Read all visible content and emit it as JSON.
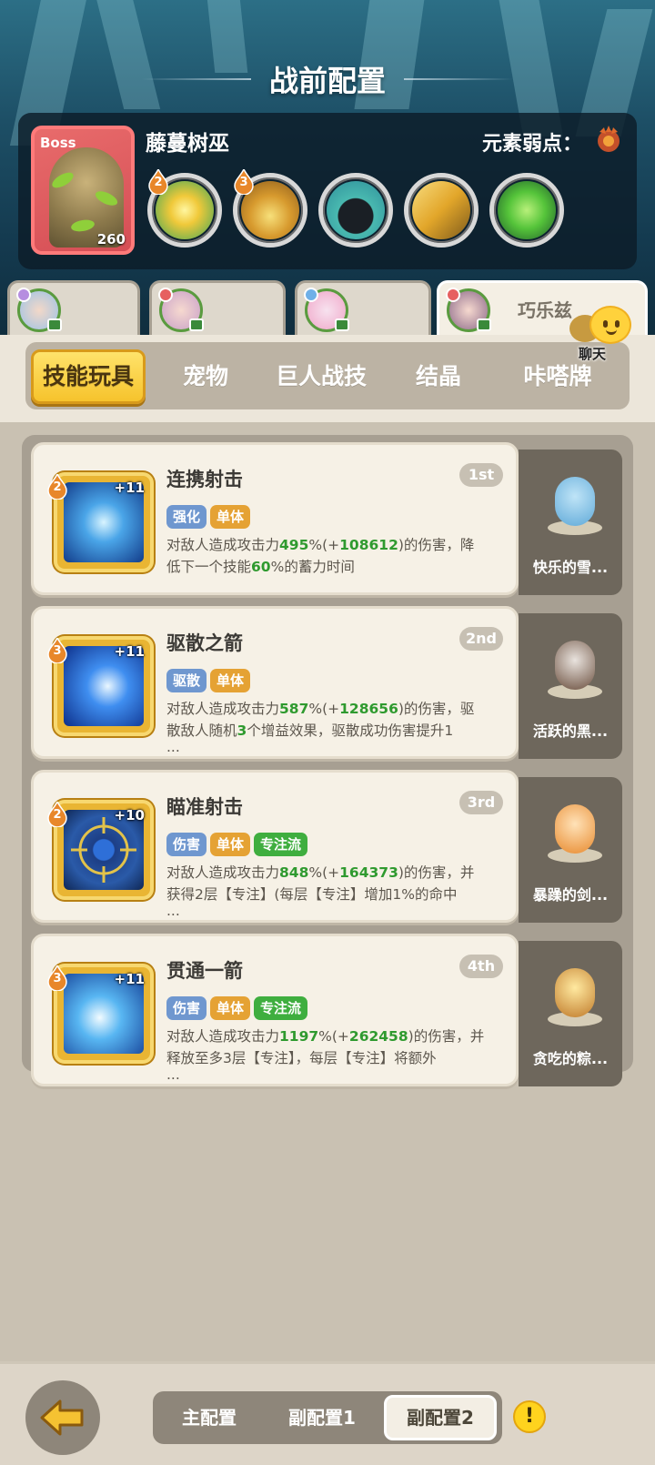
{
  "header": {
    "title": "战前配置"
  },
  "boss": {
    "tag": "Boss",
    "level": "260",
    "name": "藤蔓树巫",
    "weakness_label": "元素弱点：",
    "weakness_icon": "fire-element-icon",
    "skills": [
      {
        "icon": "explosion-skill-icon",
        "level": "2"
      },
      {
        "icon": "fire-cauldron-skill-icon",
        "level": "3"
      },
      {
        "icon": "shadow-monster-skill-icon"
      },
      {
        "icon": "golden-claw-skill-icon"
      },
      {
        "icon": "green-slime-skill-icon"
      }
    ]
  },
  "partners": [
    {
      "name": ""
    },
    {
      "name": ""
    },
    {
      "name": ""
    },
    {
      "name": "巧乐兹",
      "active": true
    }
  ],
  "chat": {
    "label": "聊天"
  },
  "categories": [
    {
      "label": "技能玩具",
      "active": true
    },
    {
      "label": "宠物"
    },
    {
      "label": "巨人战技"
    },
    {
      "label": "结晶"
    },
    {
      "label": "咔嗒牌"
    }
  ],
  "skills": [
    {
      "name": "连携射击",
      "rank": "1st",
      "level": "2",
      "plus": "+11",
      "tags": [
        {
          "text": "强化",
          "color": "blue"
        },
        {
          "text": "单体",
          "color": "orange"
        }
      ],
      "desc": {
        "p1": "对敌人造成攻击力",
        "v1": "495",
        "p2": "%(+",
        "v2": "108612",
        "p3": ")的伤害，降",
        "line2_a": "低下一个技能",
        "line2_v": "60",
        "line2_b": "%的蓄力时间"
      },
      "pet": "快乐的雪..."
    },
    {
      "name": "驱散之箭",
      "rank": "2nd",
      "level": "3",
      "plus": "+11",
      "tags": [
        {
          "text": "驱散",
          "color": "blue"
        },
        {
          "text": "单体",
          "color": "orange"
        }
      ],
      "desc": {
        "p1": "对敌人造成攻击力",
        "v1": "587",
        "p2": "%(+",
        "v2": "128656",
        "p3": ")的伤害，驱",
        "line2_a": "散敌人随机",
        "line2_v": "3",
        "line2_b": "个增益效果，驱散成功伤害提升1",
        "line3": "..."
      },
      "pet": "活跃的黑..."
    },
    {
      "name": "瞄准射击",
      "rank": "3rd",
      "level": "2",
      "plus": "+10",
      "tags": [
        {
          "text": "伤害",
          "color": "blue"
        },
        {
          "text": "单体",
          "color": "orange"
        },
        {
          "text": "专注流",
          "color": "green"
        }
      ],
      "desc": {
        "p1": "对敌人造成攻击力",
        "v1": "848",
        "p2": "%(+",
        "v2": "164373",
        "p3": ")的伤害，并",
        "line2_a": "获得2层【专注】(每层【专注】增加1%的命中",
        "line2_v": "",
        "line2_b": "",
        "line3": "..."
      },
      "pet": "暴躁的剑..."
    },
    {
      "name": "贯通一箭",
      "rank": "4th",
      "level": "3",
      "plus": "+11",
      "tags": [
        {
          "text": "伤害",
          "color": "blue"
        },
        {
          "text": "单体",
          "color": "orange"
        },
        {
          "text": "专注流",
          "color": "green"
        }
      ],
      "desc": {
        "p1": "对敌人造成攻击力",
        "v1": "1197",
        "p2": "%(+",
        "v2": "262458",
        "p3": ")的伤害，并",
        "line2_a": "释放至多3层【专注】，每层【专注】将额外",
        "line2_v": "",
        "line2_b": "",
        "line3": "..."
      },
      "pet": "贪吃的粽..."
    }
  ],
  "bottom": {
    "configs": [
      {
        "label": "主配置"
      },
      {
        "label": "副配置1"
      },
      {
        "label": "副配置2",
        "active": true
      }
    ],
    "warning": "!"
  }
}
